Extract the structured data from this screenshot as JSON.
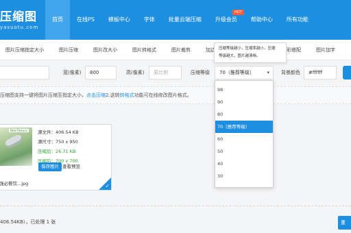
{
  "header": {
    "logo_text": "压缩图",
    "logo_sub": "yasuotu.com",
    "nav": [
      {
        "label": "首页"
      },
      {
        "label": "在线PS"
      },
      {
        "label": "模板中心"
      },
      {
        "label": "字体"
      },
      {
        "label": "批量云端压缩"
      },
      {
        "label": "升级会员"
      },
      {
        "label": "帮助中心"
      },
      {
        "label": "所有功能"
      }
    ],
    "hot_badge": "HOT",
    "active_color": "#42a6ee",
    "bar_color": "#1e8fe0"
  },
  "subnav": [
    "图片压缩指定大小",
    "图片压缩",
    "图片改大小",
    "图片转格式",
    "图片裁剪",
    "加边框",
    "色彩搭配",
    "图片加字"
  ],
  "form": {
    "width_label": "宽(像素)",
    "width_value": "800",
    "height_label": "高(像素)",
    "height_placeholder": "原比例",
    "level_label": "压缩等级",
    "level_value": "70（推荐等级）",
    "bg_label": "背景颜色",
    "bg_value": "#ffffff"
  },
  "tooltip": {
    "line1": "压缩等级越小，压缩率越小，压缩",
    "line2": "等级越大，图片越清晰。"
  },
  "dropdown": {
    "options": [
      "98",
      "90",
      "80",
      "70（推荐等级）",
      "60",
      "50",
      "40",
      "30"
    ],
    "selected_index": 3
  },
  "info": {
    "prefix": "压缩图支持一键将图片压缩至指定大小，",
    "link1": "点击压缩",
    "mid": "2.这转",
    "link2": "转格式",
    "suffix": "功能可在线修改图片格式。"
  },
  "card": {
    "thumb_tag": "New Reduce",
    "source_size": "源文件：406.54 KB",
    "source_dims": "源尺寸：750 x 950",
    "compressed_size": "压缩后：26.71 KB",
    "compressed_dims": "压缩后：700 x 700",
    "save_label": "保存图片",
    "preview_label": "查看预览",
    "filename": "强必餐饮...jpg",
    "check": "✓"
  },
  "bottom": {
    "summary": "406.54KB），已处理 1 张",
    "button_label": "重"
  }
}
